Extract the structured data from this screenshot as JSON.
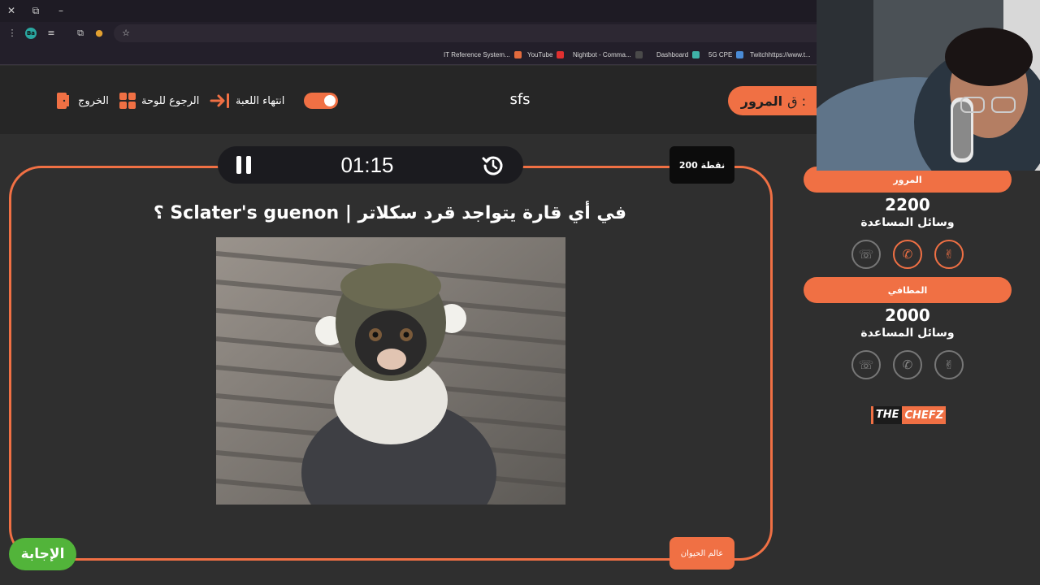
{
  "browser": {
    "window_controls": {
      "close": "✕",
      "restore": "⧉",
      "minimize": "–"
    },
    "profile_badge": "Ba",
    "bookmarks": [
      {
        "label": "IT Reference System...",
        "color": "#e26b3d"
      },
      {
        "label": "YouTube",
        "color": "#e03030"
      },
      {
        "label": "Nightbot - Comma...",
        "color": "#2d2d2d"
      },
      {
        "label": "Dashboard",
        "color": "#3fb3a8"
      },
      {
        "label": "5G CPE",
        "color": "#4a8bd6"
      },
      {
        "label": "Twitchhttps://www.t...",
        "color": "#9146ff"
      }
    ]
  },
  "header": {
    "exit_label": "الخروج",
    "back_to_board_label": "الرجوع للوحة",
    "end_game_label": "انتهاء اللعبة",
    "game_title": "sfs",
    "turn_prefix": "ق :",
    "turn_team": "المرور"
  },
  "question_panel": {
    "timer": "01:15",
    "points": "200 نقطة",
    "question": "في أي قارة يتواجد قرد سكلاتر | Sclater's guenon ؟",
    "category": "عالم الحيوان",
    "answer_button": "الإجابة"
  },
  "teams": [
    {
      "name": "المرور",
      "score": "2200",
      "aids_label": "وسائل المساعدة",
      "aids": [
        "call-swap",
        "phone",
        "two-answers"
      ],
      "aids_active": [
        false,
        true,
        true
      ]
    },
    {
      "name": "المطافي",
      "score": "2000",
      "aids_label": "وسائل المساعدة",
      "aids": [
        "call-swap",
        "phone",
        "two-answers"
      ],
      "aids_active": [
        false,
        false,
        false
      ]
    }
  ],
  "brand": {
    "the": "THE",
    "name": "CHEFZ"
  },
  "colors": {
    "accent": "#f07044",
    "answer_green": "#52b43a",
    "background": "#2f2f2f",
    "header": "#262626"
  }
}
